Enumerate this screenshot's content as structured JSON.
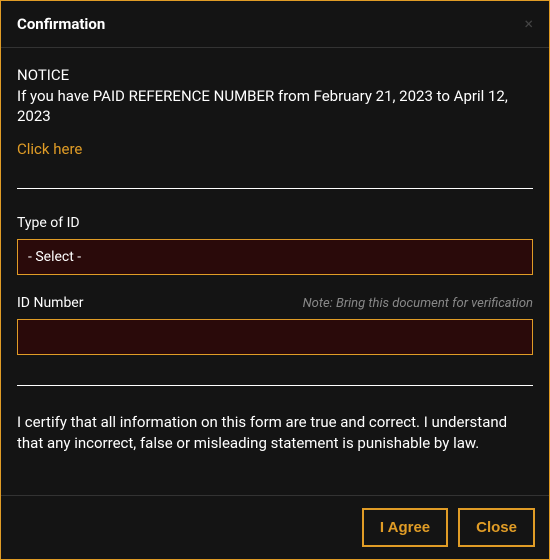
{
  "header": {
    "title": "Confirmation"
  },
  "notice": {
    "heading": "NOTICE",
    "text": "If you have PAID REFERENCE NUMBER from February 21, 2023 to April 12, 2023",
    "link_label": "Click here"
  },
  "fields": {
    "type_of_id": {
      "label": "Type of ID",
      "placeholder": "- Select -"
    },
    "id_number": {
      "label": "ID Number",
      "hint": "Note: Bring this document for verification",
      "value": ""
    }
  },
  "certification": "I certify that all information on this form are true and correct. I understand that any incorrect, false or misleading statement is punishable by law.",
  "footer": {
    "agree_label": "I Agree",
    "close_label": "Close"
  }
}
